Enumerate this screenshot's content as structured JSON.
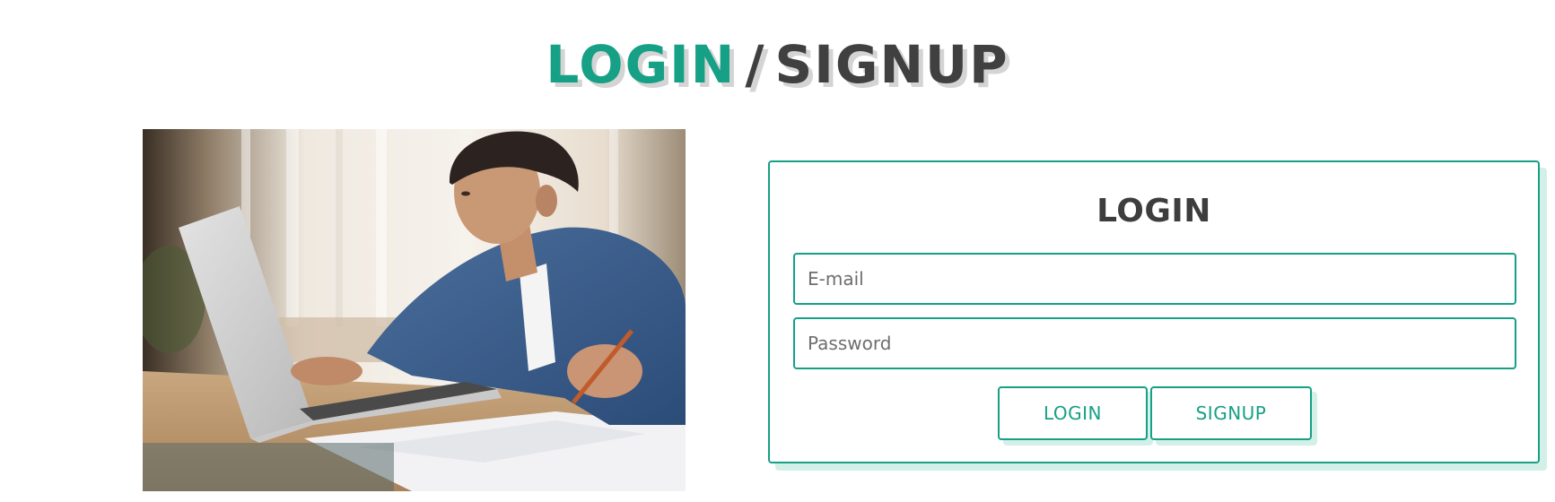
{
  "header": {
    "login_word": "LOGIN",
    "separator": "/",
    "signup_word": "SIGNUP"
  },
  "photo": {
    "subject": "boy-using-laptop-photo"
  },
  "form": {
    "title": "LOGIN",
    "email_placeholder": "E-mail",
    "email_value": "",
    "password_placeholder": "Password",
    "password_value": "",
    "login_button": "LOGIN",
    "signup_button": "SIGNUP"
  },
  "colors": {
    "accent": "#16a085",
    "heading_dark": "#404040",
    "shadow_light": "#d3f0e8"
  }
}
